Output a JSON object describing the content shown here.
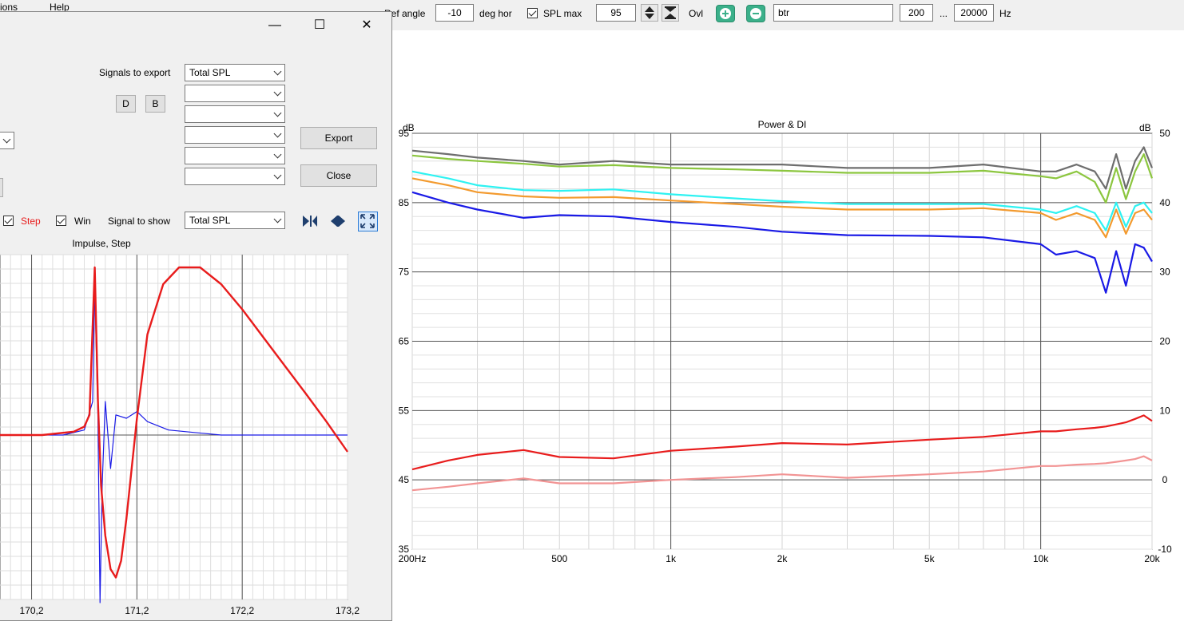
{
  "toolbar": {
    "menu_fragment_1": "ions",
    "menu_fragment_2": "Help",
    "ref_angle_label": "Ref angle",
    "ref_angle_value": "-10",
    "deg_hor_label": "deg hor",
    "spl_max_label": "SPL max",
    "spl_max_value": "95",
    "ovl_label": "Ovl",
    "name_value": "btr",
    "freq_min": "200",
    "ellipsis": "...",
    "freq_max": "20000",
    "hz_label": "Hz"
  },
  "dialog": {
    "signals_to_export_label": "Signals to export",
    "export_combos": [
      "Total SPL",
      "",
      "",
      "",
      "",
      ""
    ],
    "d_button": "D",
    "b_button": "B",
    "export_button": "Export",
    "close_button": "Close",
    "step_label": "Step",
    "win_label": "Win",
    "signal_to_show_label": "Signal to show",
    "signal_to_show_value": "Total SPL"
  },
  "impulse_chart": {
    "title": "Impulse, Step",
    "x_ticks": [
      "170,2",
      "171,2",
      "172,2",
      "173,2"
    ]
  },
  "main_chart": {
    "title": "Power & DI",
    "ylabel_left": "dB",
    "ylabel_right": "dB",
    "x_ticks": [
      "200Hz",
      "500",
      "1k",
      "2k",
      "5k",
      "10k",
      "20k"
    ],
    "y_left_ticks": [
      "95",
      "85",
      "75",
      "65",
      "55",
      "45",
      "35"
    ],
    "y_right_ticks": [
      "50",
      "40",
      "30",
      "20",
      "10",
      "0",
      "-10"
    ]
  },
  "colors": {
    "grey_series": "#6e6e6e",
    "green_series": "#8cc63f",
    "cyan_series": "#2ef2f2",
    "orange_series": "#f39a2e",
    "blue_series": "#1a1ae6",
    "red_series": "#e81c1c",
    "pink_series": "#f29494"
  },
  "chart_data": [
    {
      "type": "line",
      "title": "Power & DI",
      "xlabel": "",
      "ylabel": "dB",
      "x_scale": "log",
      "xlim": [
        200,
        20000
      ],
      "ylim": [
        35,
        95
      ],
      "y2lim": [
        -10,
        50
      ],
      "x": [
        200,
        250,
        300,
        400,
        500,
        700,
        1000,
        1500,
        2000,
        3000,
        5000,
        7000,
        10000,
        11000,
        12500,
        14000,
        15000,
        16000,
        17000,
        18000,
        19000,
        20000
      ],
      "series": [
        {
          "color": "grey",
          "axis": "left",
          "values": [
            92.5,
            92.0,
            91.5,
            91.0,
            90.5,
            91.0,
            90.5,
            90.5,
            90.5,
            90.0,
            90.0,
            90.5,
            89.5,
            89.5,
            90.5,
            89.5,
            87.0,
            92.0,
            87.0,
            91.0,
            93.0,
            90.0
          ]
        },
        {
          "color": "green",
          "axis": "left",
          "values": [
            91.8,
            91.3,
            91.0,
            90.6,
            90.2,
            90.4,
            90.0,
            89.8,
            89.6,
            89.3,
            89.3,
            89.6,
            88.8,
            88.5,
            89.5,
            88.0,
            85.0,
            90.0,
            85.5,
            89.5,
            92.0,
            88.5
          ]
        },
        {
          "color": "cyan",
          "axis": "left",
          "values": [
            89.5,
            88.5,
            87.5,
            86.8,
            86.7,
            86.9,
            86.2,
            85.6,
            85.2,
            84.8,
            84.8,
            84.8,
            84.0,
            83.5,
            84.5,
            83.5,
            81.0,
            85.0,
            81.5,
            84.5,
            85.0,
            83.5
          ]
        },
        {
          "color": "orange",
          "axis": "left",
          "values": [
            88.5,
            87.5,
            86.5,
            85.9,
            85.7,
            85.8,
            85.3,
            84.8,
            84.4,
            84.0,
            84.0,
            84.2,
            83.5,
            82.5,
            83.5,
            82.5,
            80.0,
            84.0,
            80.5,
            83.5,
            84.0,
            82.5
          ]
        },
        {
          "color": "blue",
          "axis": "left",
          "values": [
            86.5,
            85.0,
            84.0,
            82.8,
            83.2,
            83.0,
            82.2,
            81.5,
            80.8,
            80.3,
            80.2,
            80.0,
            79.0,
            77.5,
            78.0,
            77.0,
            72.0,
            78.0,
            73.0,
            79.0,
            78.5,
            76.5
          ]
        },
        {
          "color": "red",
          "axis": "right",
          "values": [
            1.5,
            2.8,
            3.6,
            4.3,
            3.3,
            3.1,
            4.2,
            4.8,
            5.3,
            5.1,
            5.8,
            6.2,
            7.0,
            7.0,
            7.3,
            7.5,
            7.7,
            8.0,
            8.3,
            8.8,
            9.3,
            8.5
          ]
        },
        {
          "color": "pink",
          "axis": "right",
          "values": [
            -1.5,
            -1.0,
            -0.5,
            0.2,
            -0.5,
            -0.5,
            0.0,
            0.4,
            0.8,
            0.3,
            0.8,
            1.2,
            2.0,
            2.0,
            2.2,
            2.3,
            2.4,
            2.6,
            2.8,
            3.0,
            3.4,
            2.8
          ]
        }
      ]
    },
    {
      "type": "line",
      "title": "Impulse, Step",
      "xlabel": "",
      "ylabel": "",
      "xlim": [
        169.9,
        173.2
      ],
      "x_ticks": [
        "170,2",
        "171,2",
        "172,2",
        "173,2"
      ],
      "series": [
        {
          "name": "Step",
          "color": "red",
          "x": [
            169.9,
            170.3,
            170.6,
            170.7,
            170.75,
            170.8,
            170.83,
            170.86,
            170.9,
            170.95,
            171.0,
            171.05,
            171.1,
            171.2,
            171.3,
            171.45,
            171.6,
            171.8,
            172.0,
            172.2,
            172.5,
            172.8,
            173.0,
            173.2
          ],
          "values": [
            0.0,
            0.0,
            0.02,
            0.05,
            0.12,
            1.0,
            0.2,
            -0.3,
            -0.6,
            -0.8,
            -0.85,
            -0.75,
            -0.5,
            0.1,
            0.6,
            0.9,
            1.0,
            1.0,
            0.9,
            0.75,
            0.5,
            0.25,
            0.08,
            -0.1
          ]
        },
        {
          "name": "Impulse",
          "color": "blue",
          "x": [
            169.9,
            170.5,
            170.7,
            170.78,
            170.8,
            170.83,
            170.85,
            170.87,
            170.9,
            170.95,
            171.0,
            171.1,
            171.2,
            171.3,
            171.5,
            172.0,
            172.5,
            173.2
          ],
          "values": [
            0.0,
            0.0,
            0.03,
            0.2,
            0.9,
            0.1,
            -1.0,
            -0.3,
            0.2,
            -0.2,
            0.12,
            0.1,
            0.14,
            0.08,
            0.03,
            0.0,
            0.0,
            0.0
          ]
        }
      ]
    }
  ]
}
